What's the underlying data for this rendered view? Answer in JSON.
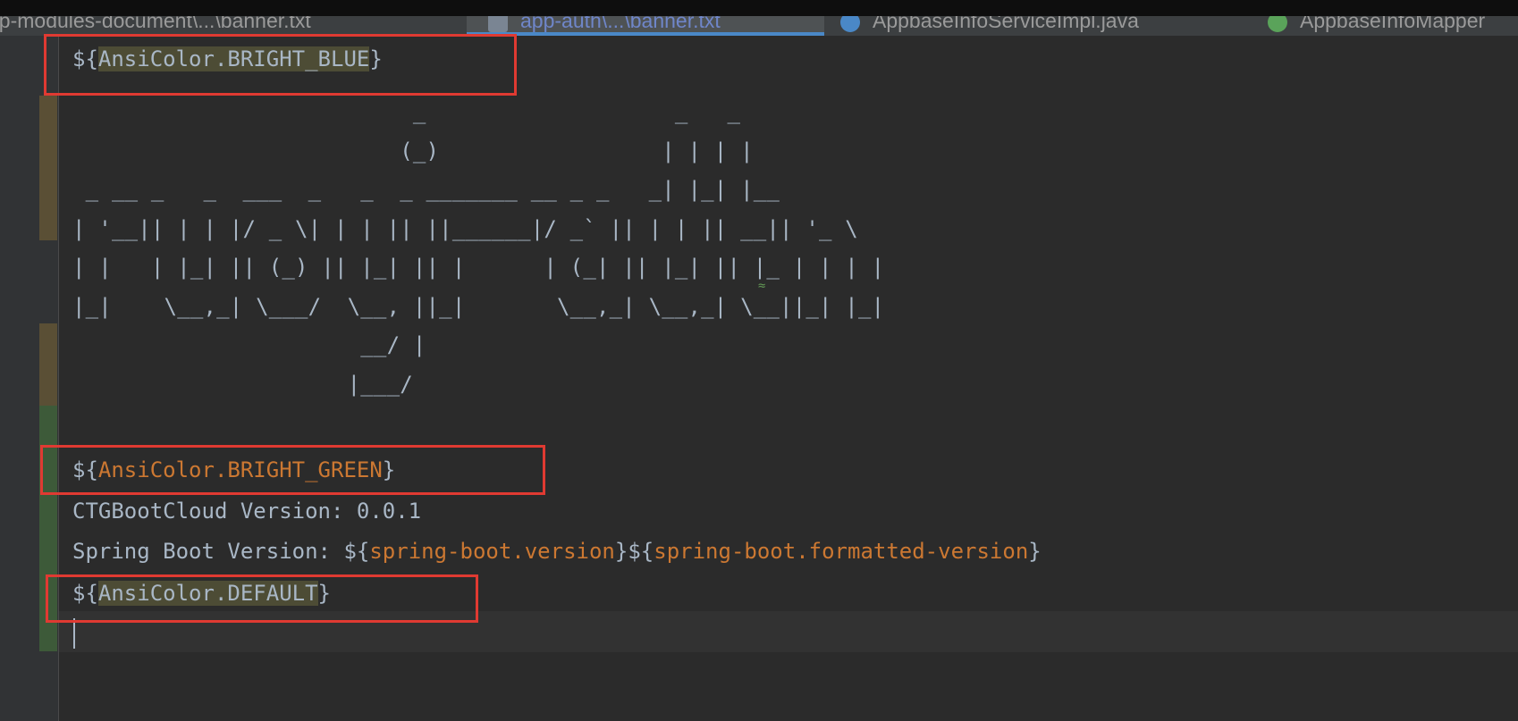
{
  "tabs": [
    {
      "label": "pp-modules-document\\...\\banner.txt",
      "active": false,
      "icon": "text-file-icon"
    },
    {
      "label": "app-auth\\...\\banner.txt",
      "active": true,
      "icon": "text-file-icon"
    },
    {
      "label": "AppbaseInfoServiceImpl.java",
      "active": false,
      "icon": "java-class-icon"
    },
    {
      "label": "AppbaseInfoMapper",
      "active": false,
      "icon": "java-interface-icon"
    }
  ],
  "editor": {
    "line1": {
      "prefix": "${",
      "token": "AnsiColor.BRIGHT_BLUE",
      "suffix": "}"
    },
    "ascii_art": [
      "                          _                   _   _",
      "                         (_)                 | | | |",
      " _ __ _   _  ___  _   _  _ _______ __ _ _   _| |_| |__",
      "| '__|| | | |/ _ \\| | | || ||______|/ _` || | | || __|| '_ \\",
      "| |   | |_| || (_) || |_| || |      | (_| || |_| || |_ | | | |",
      "|_|    \\__,_| \\___/  \\__, ||_|       \\__,_| \\__,_| \\__||_| |_|",
      "                      __/ |",
      "                     |___/"
    ],
    "line_green": {
      "prefix": "${",
      "token": "AnsiColor.BRIGHT_GREEN",
      "suffix": "}"
    },
    "line_version": "CTGBootCloud Version: 0.0.1",
    "line_spring": {
      "label": "Spring Boot Version: ",
      "p1": "${",
      "t1": "spring-boot.version",
      "s1": "}",
      "p2": "${",
      "t2": "spring-boot.formatted-version",
      "s2": "}"
    },
    "line_default": {
      "prefix": "${",
      "token": "AnsiColor.DEFAULT",
      "suffix": "}"
    }
  },
  "colors": {
    "token_orange": "#cc7832",
    "text": "#a9b7c6",
    "highlight": "#4d4c35",
    "annotation_box": "#e03a32",
    "active_tab_underline": "#4a88c7"
  }
}
